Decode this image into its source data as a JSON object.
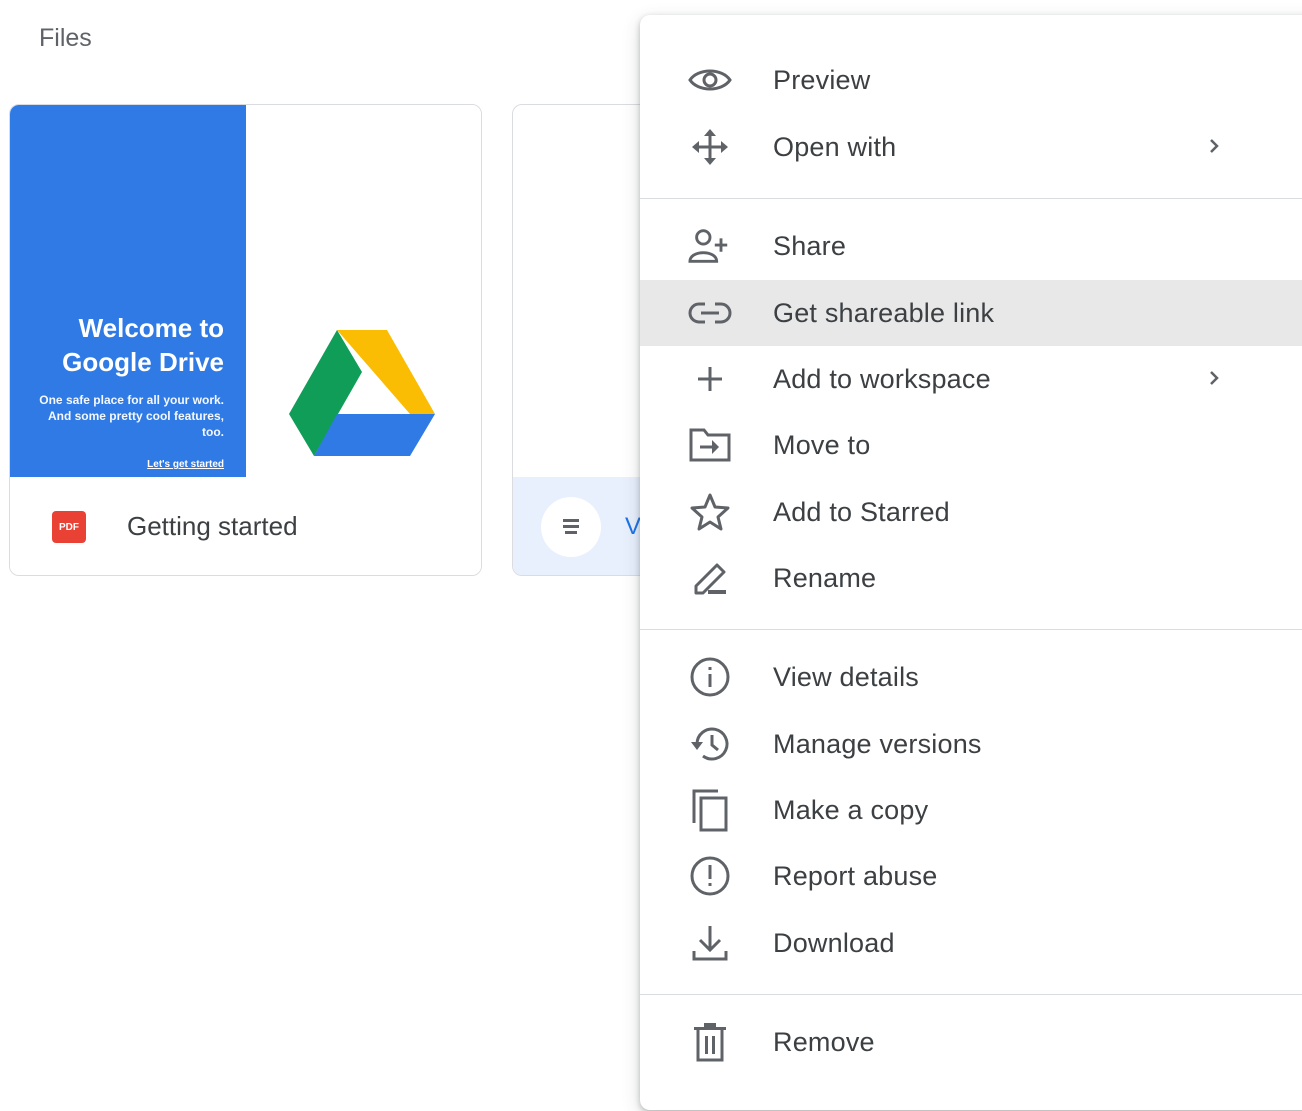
{
  "header": {
    "files_label": "Files"
  },
  "cards": [
    {
      "name": "Getting started",
      "type_badge": "PDF",
      "thumbnail": {
        "title": "Welcome to Google Drive",
        "tagline": "One safe place for all your work. And some pretty cool features, too.",
        "cta": "Let's get started"
      }
    },
    {
      "name": "V",
      "icon": "doc-icon"
    }
  ],
  "menu": {
    "items": [
      {
        "label": "Preview",
        "icon": "eye-icon"
      },
      {
        "label": "Open with",
        "icon": "move-arrows-icon",
        "submenu": true
      },
      {
        "label": "Share",
        "icon": "person-add-icon"
      },
      {
        "label": "Get shareable link",
        "icon": "link-icon",
        "highlighted": true
      },
      {
        "label": "Add to workspace",
        "icon": "plus-icon",
        "submenu": true
      },
      {
        "label": "Move to",
        "icon": "folder-move-icon"
      },
      {
        "label": "Add to Starred",
        "icon": "star-icon"
      },
      {
        "label": "Rename",
        "icon": "pencil-icon"
      },
      {
        "label": "View details",
        "icon": "info-icon"
      },
      {
        "label": "Manage versions",
        "icon": "history-icon"
      },
      {
        "label": "Make a copy",
        "icon": "copy-icon"
      },
      {
        "label": "Report abuse",
        "icon": "report-icon"
      },
      {
        "label": "Download",
        "icon": "download-icon"
      },
      {
        "label": "Remove",
        "icon": "trash-icon"
      }
    ]
  },
  "colors": {
    "highlight": "#e8e8e9",
    "drive_blue": "#2f7ae5",
    "pdf_red": "#e94235",
    "link_blue": "#1a73e8"
  }
}
